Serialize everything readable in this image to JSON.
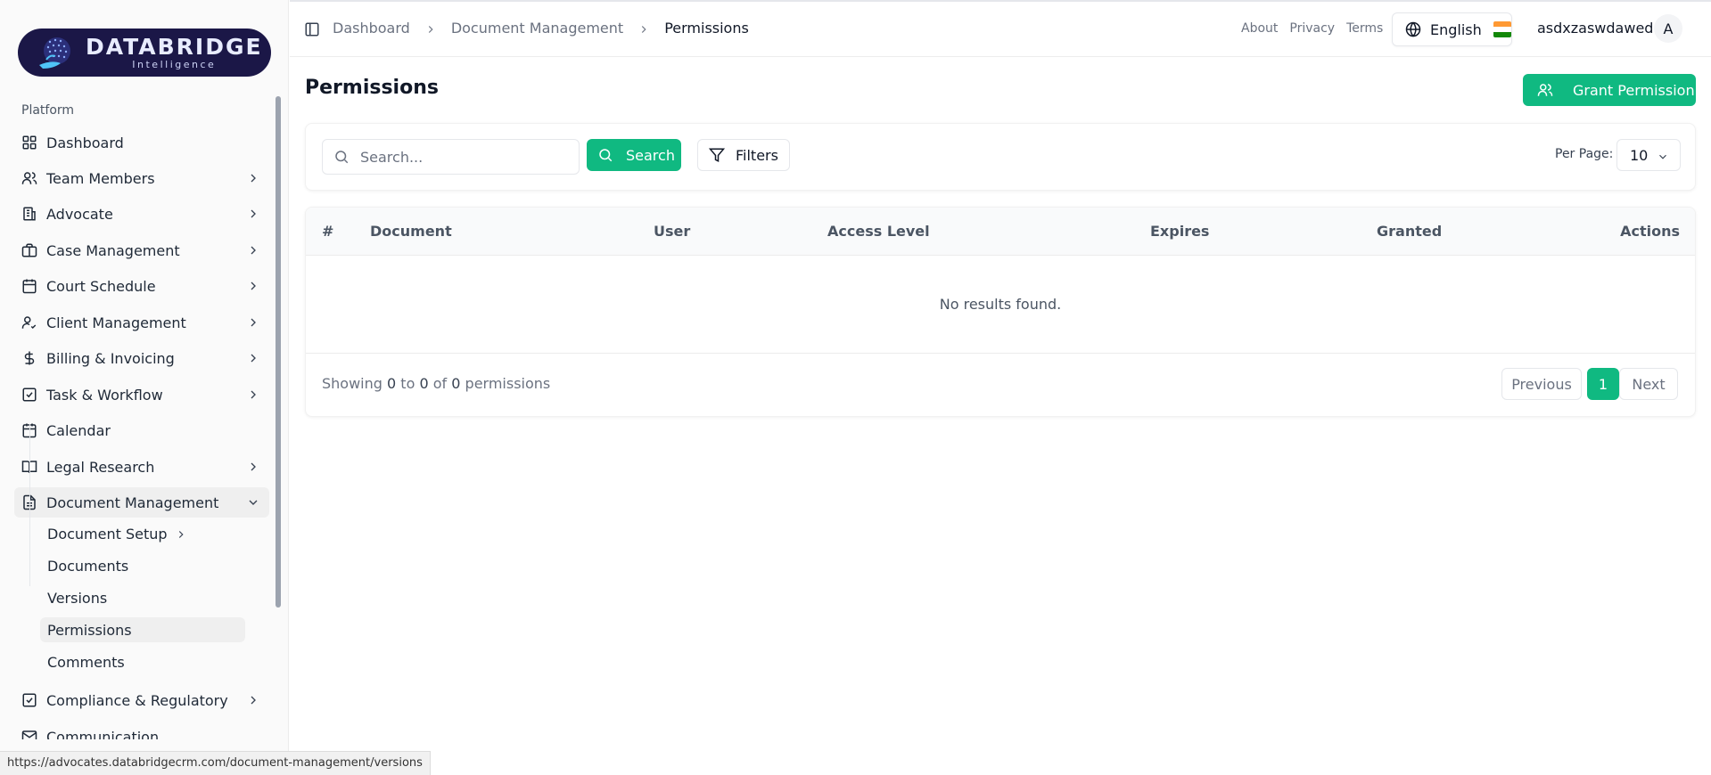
{
  "logo": {
    "name": "DATABRIDGE",
    "sub": "Intelligence"
  },
  "sidebar": {
    "section": "Platform",
    "items": [
      {
        "label": "Dashboard",
        "icon": "grid-icon",
        "chevron": false
      },
      {
        "label": "Team Members",
        "icon": "users-icon",
        "chevron": true
      },
      {
        "label": "Advocate",
        "icon": "building-icon",
        "chevron": true
      },
      {
        "label": "Case Management",
        "icon": "briefcase-icon",
        "chevron": true
      },
      {
        "label": "Court Schedule",
        "icon": "calendar-icon",
        "chevron": true
      },
      {
        "label": "Client Management",
        "icon": "user-check-icon",
        "chevron": true
      },
      {
        "label": "Billing & Invoicing",
        "icon": "dollar-icon",
        "chevron": true
      },
      {
        "label": "Task & Workflow",
        "icon": "check-square-icon",
        "chevron": true
      },
      {
        "label": "Calendar",
        "icon": "calendar-icon",
        "chevron": false
      },
      {
        "label": "Legal Research",
        "icon": "book-icon",
        "chevron": true
      },
      {
        "label": "Document Management",
        "icon": "file-icon",
        "chevron": true,
        "open": true
      },
      {
        "label": "Compliance & Regulatory",
        "icon": "check-square-icon",
        "chevron": true
      },
      {
        "label": "Communication",
        "icon": "mail-icon",
        "chevron": true
      }
    ],
    "subitems": [
      {
        "label": "Document Setup",
        "chevron": true
      },
      {
        "label": "Documents"
      },
      {
        "label": "Versions"
      },
      {
        "label": "Permissions",
        "active": true
      },
      {
        "label": "Comments"
      }
    ]
  },
  "header": {
    "breadcrumb": [
      "Dashboard",
      "Document Management",
      "Permissions"
    ],
    "links": [
      "About",
      "Privacy",
      "Terms"
    ],
    "language": "English",
    "user_name": "asdxzaswdawed",
    "avatar_initial": "A"
  },
  "main": {
    "title": "Permissions",
    "grant_button": "Grant Permission",
    "search_placeholder": "Search...",
    "search_button": "Search",
    "filters_button": "Filters",
    "per_page_label": "Per Page:",
    "per_page_value": "10",
    "columns": [
      "#",
      "Document",
      "User",
      "Access Level",
      "Expires",
      "Granted",
      "Actions"
    ],
    "empty_text": "No results found.",
    "showing": {
      "prefix": "Showing",
      "from": "0",
      "to_word": "to",
      "to": "0",
      "of_word": "of",
      "total": "0",
      "suffix": "permissions"
    },
    "pagination": {
      "previous": "Previous",
      "page": "1",
      "next": "Next"
    }
  },
  "status_url": "https://advocates.databridgecrm.com/document-management/versions",
  "colors": {
    "accent": "#10b981",
    "logo_bg": "#1b1747"
  }
}
